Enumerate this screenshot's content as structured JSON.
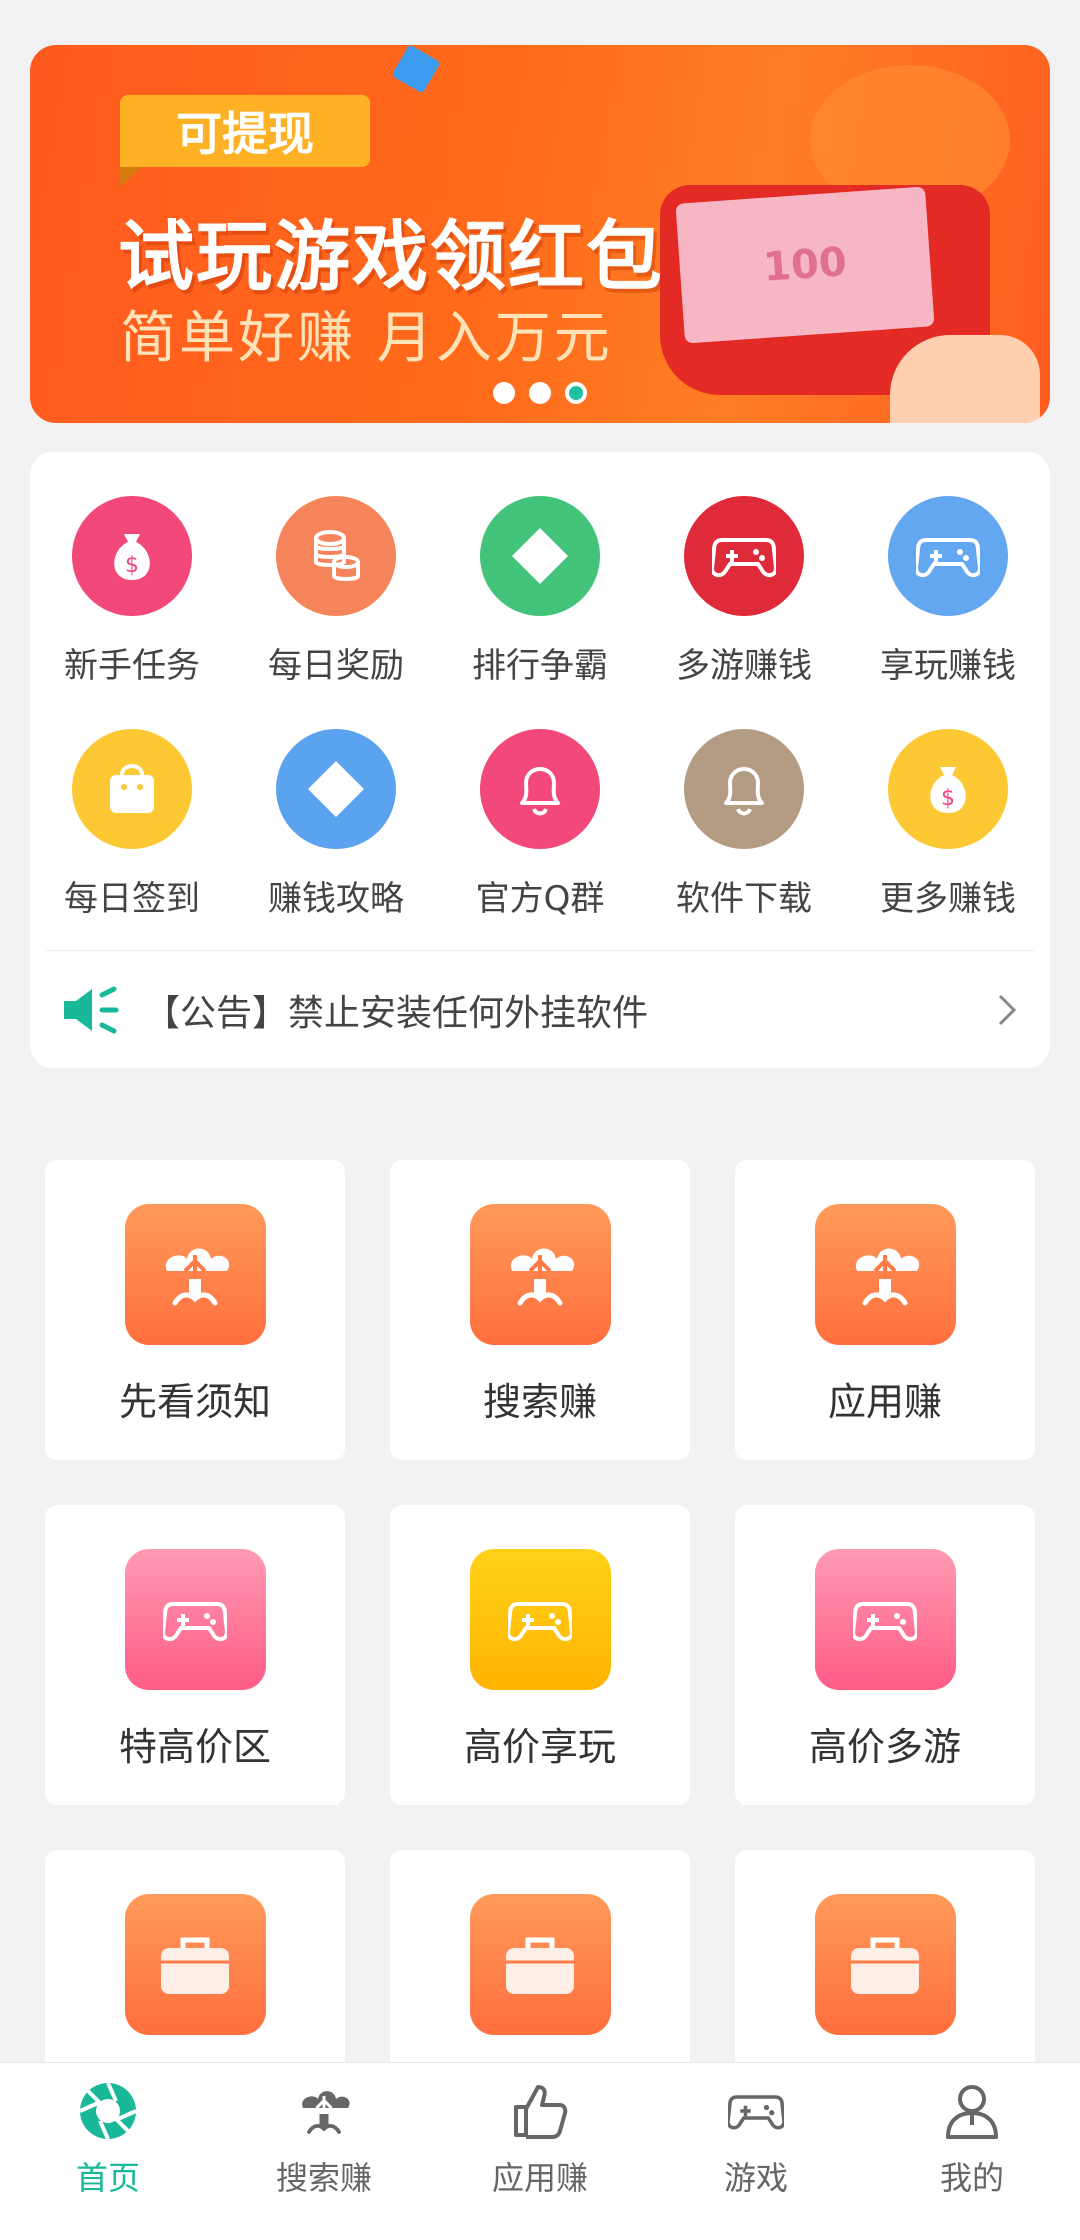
{
  "banner": {
    "tag": "可提现",
    "headline": "试玩游戏领红包",
    "subline": "简单好赚  月入万元",
    "bill_value": "100",
    "slides": 3,
    "active_slide": 3
  },
  "quick_menu": [
    {
      "label": "新手任务",
      "icon": "money-bag-icon",
      "color": "#f2487a"
    },
    {
      "label": "每日奖励",
      "icon": "coins-icon",
      "color": "#f5845a"
    },
    {
      "label": "排行争霸",
      "icon": "diamond-icon",
      "color": "#43c27a"
    },
    {
      "label": "多游赚钱",
      "icon": "gamepad-icon",
      "color": "#df2a3a"
    },
    {
      "label": "享玩赚钱",
      "icon": "gamepad-icon",
      "color": "#63a7f0"
    },
    {
      "label": "每日签到",
      "icon": "shopping-bag-icon",
      "color": "#fcc834"
    },
    {
      "label": "赚钱攻略",
      "icon": "diamond-icon",
      "color": "#5ba3ee"
    },
    {
      "label": "官方Q群",
      "icon": "bell-icon",
      "color": "#f2487a"
    },
    {
      "label": "软件下载",
      "icon": "bell-icon",
      "color": "#b49c84"
    },
    {
      "label": "更多赚钱",
      "icon": "money-bag-icon",
      "color": "#fcc834"
    }
  ],
  "notice": {
    "text": "【公告】禁止安装任何外挂软件",
    "icon": "speaker-icon",
    "accent": "#19b899"
  },
  "tiles": [
    {
      "label": "先看须知",
      "icon": "tree-icon",
      "gradient": "orange"
    },
    {
      "label": "搜索赚",
      "icon": "tree-icon",
      "gradient": "orange"
    },
    {
      "label": "应用赚",
      "icon": "tree-icon",
      "gradient": "orange"
    },
    {
      "label": "特高价区",
      "icon": "gamepad-icon",
      "gradient": "pink"
    },
    {
      "label": "高价享玩",
      "icon": "gamepad-icon",
      "gradient": "yellow"
    },
    {
      "label": "高价多游",
      "icon": "gamepad-icon",
      "gradient": "pink"
    },
    {
      "label": "",
      "icon": "briefcase-icon",
      "gradient": "orange"
    },
    {
      "label": "",
      "icon": "briefcase-icon",
      "gradient": "orange"
    },
    {
      "label": "",
      "icon": "briefcase-icon",
      "gradient": "orange"
    }
  ],
  "bottom_nav": [
    {
      "label": "首页",
      "icon": "aperture-icon",
      "active": true
    },
    {
      "label": "搜索赚",
      "icon": "tree-icon",
      "active": false
    },
    {
      "label": "应用赚",
      "icon": "thumbs-up-icon",
      "active": false
    },
    {
      "label": "游戏",
      "icon": "gamepad-icon",
      "active": false
    },
    {
      "label": "我的",
      "icon": "user-icon",
      "active": false
    }
  ],
  "colors": {
    "accent": "#19b899",
    "background": "#f2f2f4"
  }
}
